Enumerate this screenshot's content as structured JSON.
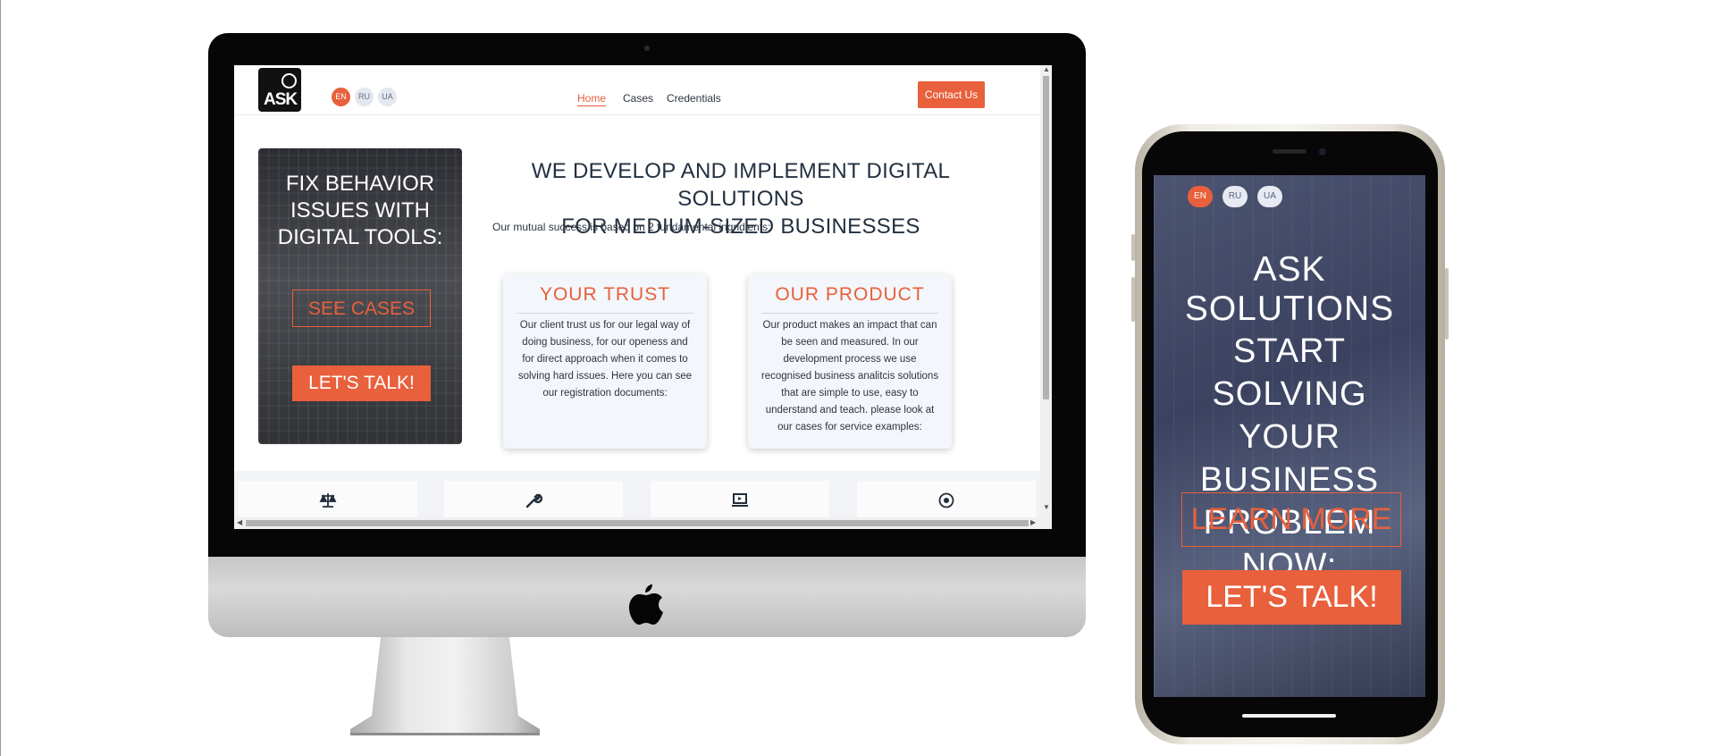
{
  "desktop_site": {
    "logo_text": "ASK",
    "languages": [
      {
        "code": "EN",
        "active": true
      },
      {
        "code": "RU",
        "active": false
      },
      {
        "code": "UA",
        "active": false
      }
    ],
    "nav": [
      {
        "label": "Home",
        "active": true
      },
      {
        "label": "Cases",
        "active": false
      },
      {
        "label": "Credentials",
        "active": false
      }
    ],
    "contact_button": "Contact Us",
    "hero": {
      "title_lines": [
        "FIX BEHAVIOR",
        "ISSUES WITH",
        "DIGITAL TOOLS:"
      ],
      "see_cases": "SEE CASES",
      "lets_talk": "LET'S TALK!"
    },
    "heading_lines": [
      "WE DEVELOP AND IMPLEMENT DIGITAL SOLUTIONS",
      "FOR MEDIUM-SIZED BUSINESSES"
    ],
    "subline": "Our mutual success is based on 2 fundamental ingridients:",
    "cards": [
      {
        "title": "YOUR TRUST",
        "body": "Our client trust us for our legal way of doing business, for our openess and for direct approach when it comes to solving hard issues. Here you can see our registration documents:"
      },
      {
        "title": "OUR PRODUCT",
        "body": "Our product makes an impact that can be seen and measured. In our development process we use recognised business analitcis solutions that are simple to use, easy to understand and teach. please look at our cases for service examples:"
      }
    ],
    "service_icons": [
      "scale-icon",
      "wrench-icon",
      "laptop-icon",
      "target-icon"
    ]
  },
  "mobile_site": {
    "languages": [
      {
        "code": "EN",
        "active": true
      },
      {
        "code": "RU",
        "active": false
      },
      {
        "code": "UA",
        "active": false
      }
    ],
    "brand": "ASK SOLUTIONS",
    "title_lines": [
      "START SOLVING",
      "YOUR BUSINESS",
      "PROBLEM NOW:"
    ],
    "learn_more": "LEARN MORE",
    "lets_talk": "LET'S TALK!"
  },
  "colors": {
    "accent": "#e8603c",
    "heading_text": "#223040",
    "card_bg": "#f3f6fa"
  }
}
